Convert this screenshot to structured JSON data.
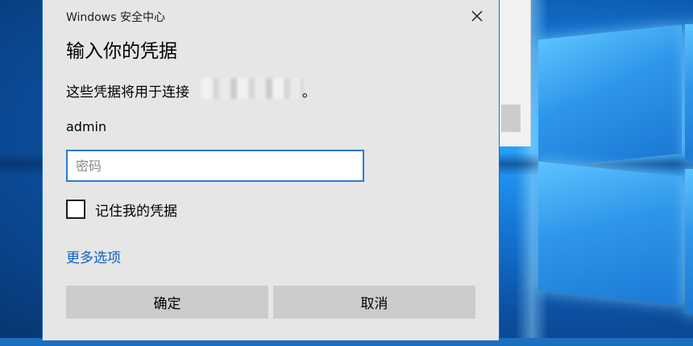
{
  "window": {
    "app_title": "Windows 安全中心",
    "close_icon": "close-icon"
  },
  "dialog": {
    "heading": "输入你的凭据",
    "description": "这些凭据将用于连接",
    "description_end": "。",
    "username": "admin",
    "password_placeholder": "密码",
    "password_value": "",
    "remember_label": "记住我的凭据",
    "remember_checked": false,
    "more_options": "更多选项",
    "ok_label": "确定",
    "cancel_label": "取消"
  },
  "colors": {
    "accent": "#0a62c9",
    "input_border": "#2b7ad1",
    "dialog_bg": "#e6e6e6",
    "button_bg": "#cccccc"
  }
}
